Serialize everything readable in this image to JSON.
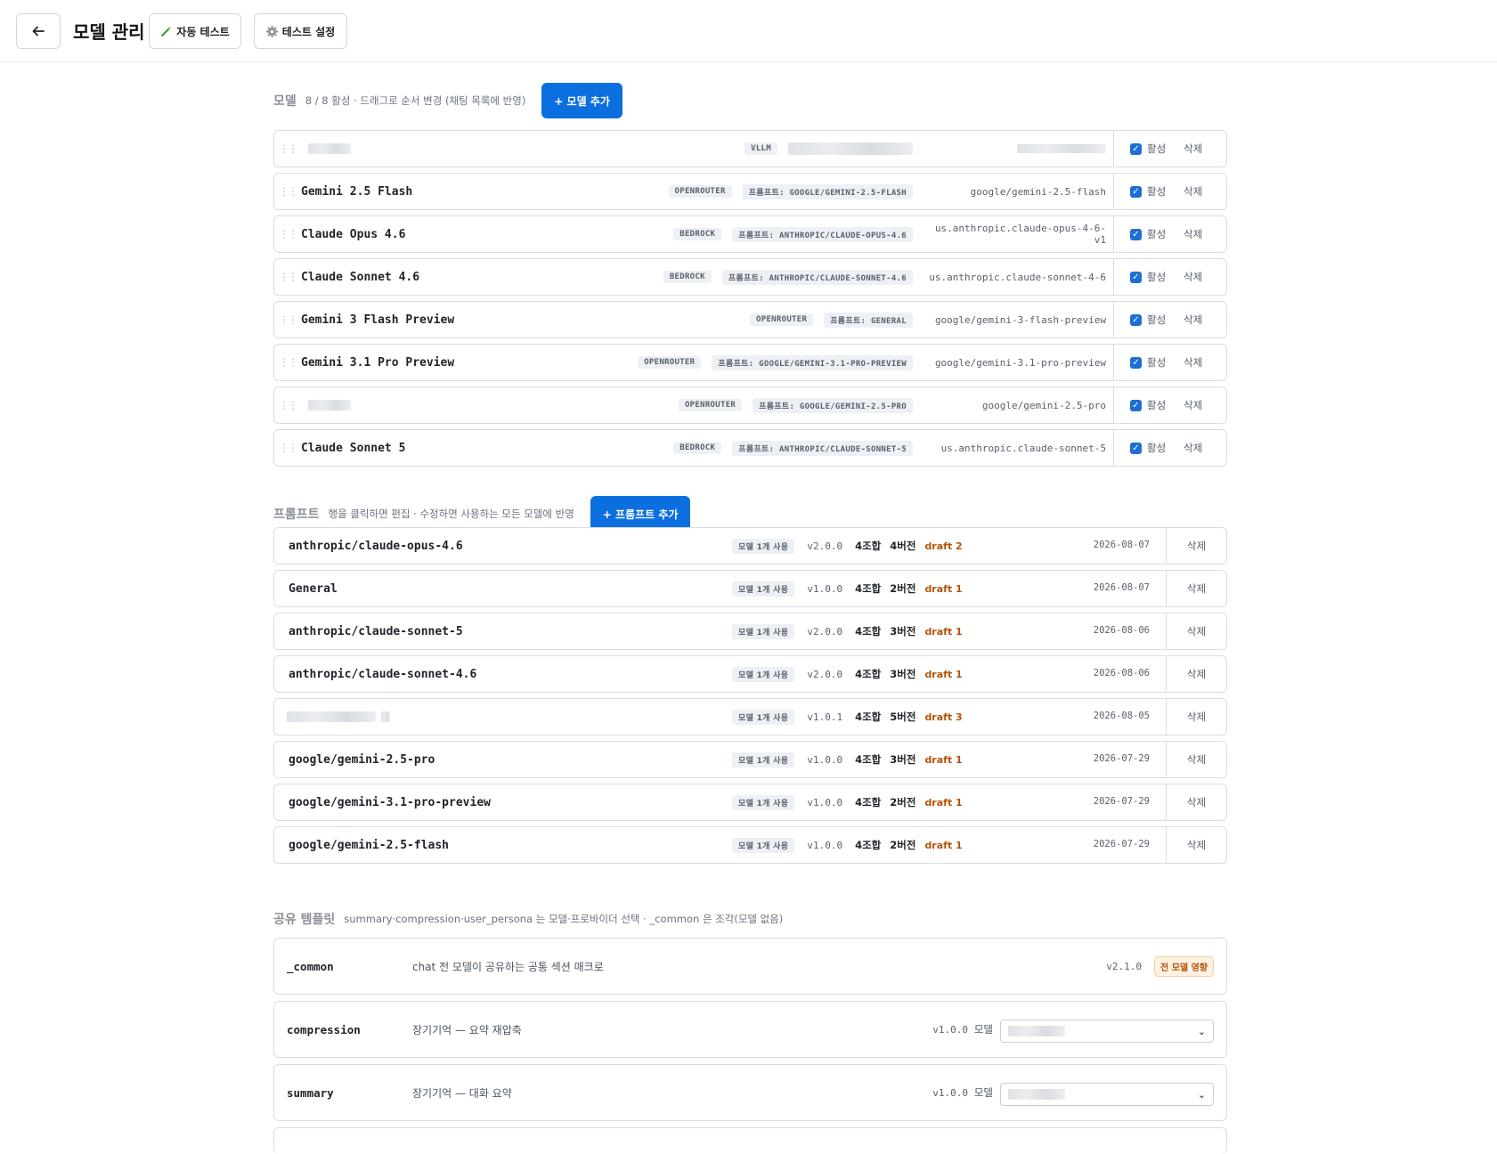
{
  "header": {
    "back_icon": "arrow-left-icon",
    "title": "모델 관리",
    "auto_test_label": "자동 테스트",
    "test_settings_label": "테스트 설정"
  },
  "models_section": {
    "title": "모델",
    "desc": "8 / 8 활성 · 드래그로 순서 변경 (채팅 목록에 반영)",
    "add_label": "+ 모델 추가",
    "active_label": "활성",
    "delete_label": "삭제",
    "rows": [
      {
        "name": "",
        "provider": "VLLM",
        "prompt": "",
        "model_id": ""
      },
      {
        "name": "Gemini 2.5 Flash",
        "provider": "OPENROUTER",
        "prompt": "프롬프트: GOOGLE/GEMINI-2.5-FLASH",
        "model_id": "google/gemini-2.5-flash"
      },
      {
        "name": "Claude Opus 4.6",
        "provider": "BEDROCK",
        "prompt": "프롬프트: ANTHROPIC/CLAUDE-OPUS-4.6",
        "model_id": "us.anthropic.claude-opus-4-6-v1"
      },
      {
        "name": "Claude Sonnet 4.6",
        "provider": "BEDROCK",
        "prompt": "프롬프트: ANTHROPIC/CLAUDE-SONNET-4.6",
        "model_id": "us.anthropic.claude-sonnet-4-6"
      },
      {
        "name": "Gemini 3 Flash Preview",
        "provider": "OPENROUTER",
        "prompt": "프롬프트: GENERAL",
        "model_id": "google/gemini-3-flash-preview"
      },
      {
        "name": "Gemini 3.1 Pro Preview",
        "provider": "OPENROUTER",
        "prompt": "프롬프트: GOOGLE/GEMINI-3.1-PRO-PREVIEW",
        "model_id": "google/gemini-3.1-pro-preview"
      },
      {
        "name": "",
        "provider": "OPENROUTER",
        "prompt": "프롬프트: GOOGLE/GEMINI-2.5-PRO",
        "model_id": "google/gemini-2.5-pro"
      },
      {
        "name": "Claude Sonnet 5",
        "provider": "BEDROCK",
        "prompt": "프롬프트: ANTHROPIC/CLAUDE-SONNET-5",
        "model_id": "us.anthropic.claude-sonnet-5"
      }
    ]
  },
  "prompts_section": {
    "title": "프롬프트",
    "desc": "행을 클릭하면 편집 · 수정하면 사용하는 모든 모델에 반영",
    "add_label": "+ 프롬프트 추가",
    "delete_label": "삭제",
    "rows": [
      {
        "name": "anthropic/claude-opus-4.6",
        "usage": "모델 1개 사용",
        "version": "v2.0.0",
        "combos": "4조합",
        "versions": "4버전",
        "draft": "draft 2",
        "date": "2026-08-07"
      },
      {
        "name": "General",
        "usage": "모델 1개 사용",
        "version": "v1.0.0",
        "combos": "4조합",
        "versions": "2버전",
        "draft": "draft 1",
        "date": "2026-08-07"
      },
      {
        "name": "anthropic/claude-sonnet-5",
        "usage": "모델 1개 사용",
        "version": "v2.0.0",
        "combos": "4조합",
        "versions": "3버전",
        "draft": "draft 1",
        "date": "2026-08-06"
      },
      {
        "name": "anthropic/claude-sonnet-4.6",
        "usage": "모델 1개 사용",
        "version": "v2.0.0",
        "combos": "4조합",
        "versions": "3버전",
        "draft": "draft 1",
        "date": "2026-08-06"
      },
      {
        "name": "",
        "usage": "모델 1개 사용",
        "version": "v1.0.1",
        "combos": "4조합",
        "versions": "5버전",
        "draft": "draft 3",
        "date": "2026-08-05"
      },
      {
        "name": "google/gemini-2.5-pro",
        "usage": "모델 1개 사용",
        "version": "v1.0.0",
        "combos": "4조합",
        "versions": "3버전",
        "draft": "draft 1",
        "date": "2026-07-29"
      },
      {
        "name": "google/gemini-3.1-pro-preview",
        "usage": "모델 1개 사용",
        "version": "v1.0.0",
        "combos": "4조합",
        "versions": "2버전",
        "draft": "draft 1",
        "date": "2026-07-29"
      },
      {
        "name": "google/gemini-2.5-flash",
        "usage": "모델 1개 사용",
        "version": "v1.0.0",
        "combos": "4조합",
        "versions": "2버전",
        "draft": "draft 1",
        "date": "2026-07-29"
      }
    ]
  },
  "templates_section": {
    "title": "공유 템플릿",
    "desc": "summary·compression·user_persona 는 모델·프로바이더 선택 · _common 은 조각(모델 없음)",
    "model_label": "모델",
    "rows": [
      {
        "name": "_common",
        "desc": "chat 전 모델이 공유하는 공통 섹션 매크로",
        "version": "v2.1.0",
        "badge": "전 모델 영향"
      },
      {
        "name": "compression",
        "desc": "장기기억 — 요약 재압축",
        "version": "v1.0.0"
      },
      {
        "name": "summary",
        "desc": "장기기억 — 대화 요약",
        "version": "v1.0.0"
      }
    ]
  }
}
